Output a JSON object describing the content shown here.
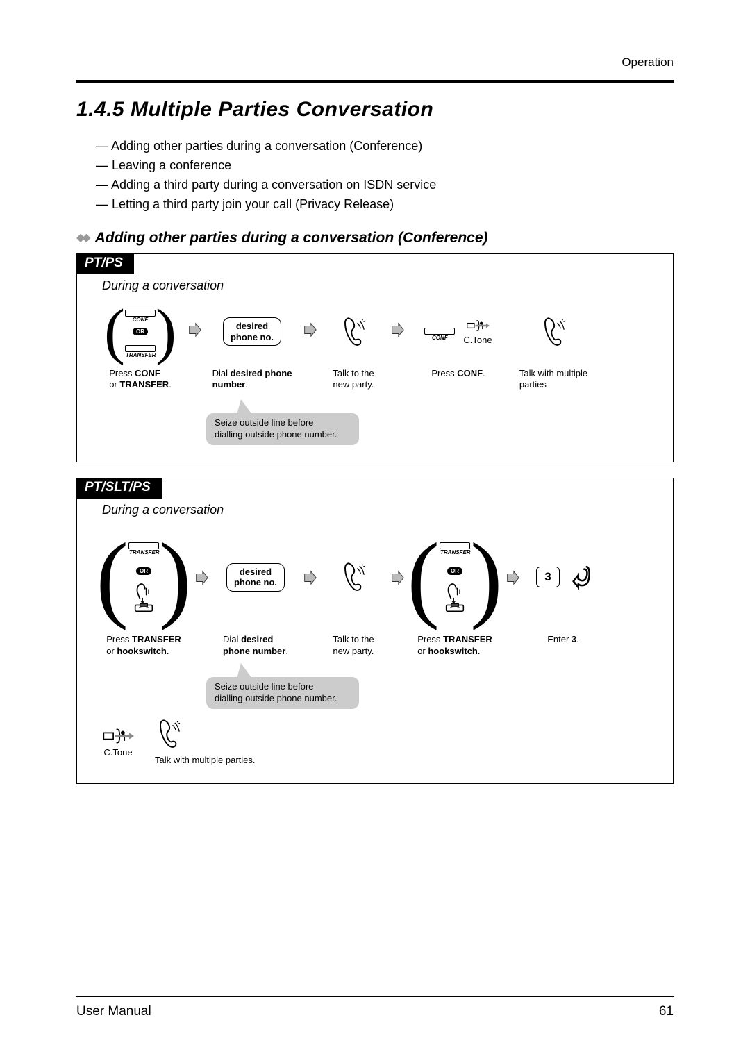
{
  "header": {
    "section": "Operation"
  },
  "title": "1.4.5   Multiple Parties Conversation",
  "bullets": [
    "— Adding other parties during a conversation (Conference)",
    "— Leaving a conference",
    "— Adding a third party during a conversation on ISDN service",
    "— Letting a third party join your call (Privacy Release)"
  ],
  "subheading": "Adding other parties during a conversation (Conference)",
  "box1": {
    "tab": "PT/PS",
    "context": "During a conversation",
    "keys": {
      "conf": "CONF",
      "transfer": "TRANSFER",
      "or": "OR"
    },
    "phone_box": "desired\nphone no.",
    "captions": {
      "step1a": "Press ",
      "step1b": "CONF",
      "step1c": "\nor ",
      "step1d": "TRANSFER",
      "step1e": ".",
      "step2a": "Dial ",
      "step2b": "desired phone",
      "step2c": "\n",
      "step2d": "number",
      "step2e": ".",
      "step3": "Talk to the\nnew party.",
      "step4a": "Press ",
      "step4b": "CONF",
      "step4c": ".",
      "ctone": "C.Tone",
      "step5": "Talk with multiple\nparties"
    },
    "callout": "Seize outside line before\ndialling outside phone number."
  },
  "box2": {
    "tab": "PT/SLT/PS",
    "context": "During a conversation",
    "keys": {
      "transfer": "TRANSFER",
      "or": "OR"
    },
    "phone_box": "desired\nphone no.",
    "digit": "3",
    "captions": {
      "step1a": "Press ",
      "step1b": "TRANSFER",
      "step1c": "\nor ",
      "step1d": "hookswitch",
      "step1e": ".",
      "step2a": "Dial ",
      "step2b": "desired",
      "step2c": "\n",
      "step2d": "phone number",
      "step2e": ".",
      "step3": "Talk to the\nnew party.",
      "step4a": "Press ",
      "step4b": "TRANSFER",
      "step4c": "\nor ",
      "step4d": "hookswitch",
      "step4e": ".",
      "step5a": "Enter ",
      "step5b": "3",
      "step5c": ".",
      "ctone": "C.Tone",
      "step6": "Talk with multiple parties."
    },
    "callout": "Seize outside line before\ndialling outside phone number."
  },
  "footer": {
    "left": "User Manual",
    "right": "61"
  }
}
